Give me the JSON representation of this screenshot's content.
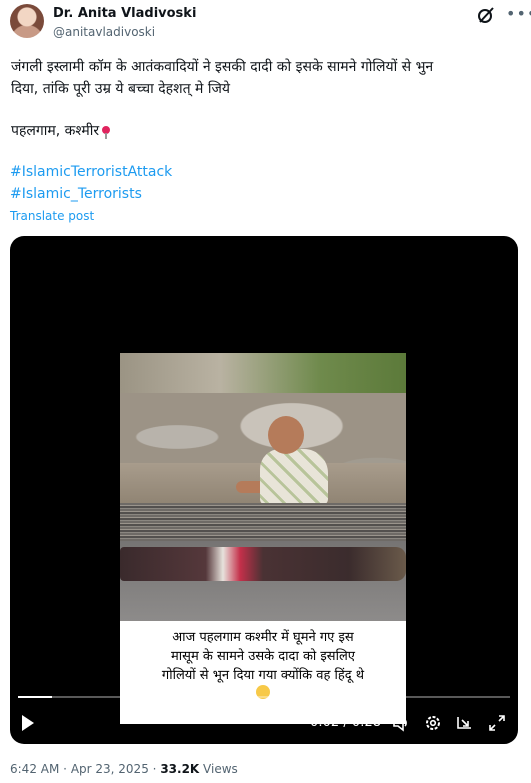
{
  "author": {
    "name": "Dr. Anita Vladivoski",
    "handle": "@anitavladivoski"
  },
  "post": {
    "line1": "जंगली इस्लामी कॉम के आतंकवादियों ने इसकी दादी को इसके सामने गोलियों से भुन",
    "line2": "दिया, तांकि पूरी उम्र ये बच्चा देहशत् मे जिये",
    "location": "पहलगाम, कश्मीर",
    "hashtags": [
      "#IslamicTerroristAttack",
      "#Islamic_Terrorists"
    ],
    "translate_label": "Translate post"
  },
  "video": {
    "caption_lines": [
      "आज पहलगाम कश्मीर में घूमने गए इस",
      "मासूम के सामने उसके दादा को इसलिए",
      "गोलियों से भून दिया गया क्योंकि वह हिंदू थे"
    ],
    "time": "0:02 / 0:28",
    "progress": 0.07
  },
  "meta": {
    "time": "6:42 AM",
    "separator": "·",
    "date": "Apr 23, 2025",
    "views_count": "33.2K",
    "views_label": "Views"
  },
  "colors": {
    "link": "#1d9bf0",
    "muted": "#536471",
    "text": "#0f1419"
  },
  "icons": [
    "grok-icon",
    "more-icon",
    "pin-icon",
    "play-icon",
    "volume-icon",
    "settings-icon",
    "pip-icon",
    "fullscreen-icon",
    "sad-face-emoji"
  ]
}
